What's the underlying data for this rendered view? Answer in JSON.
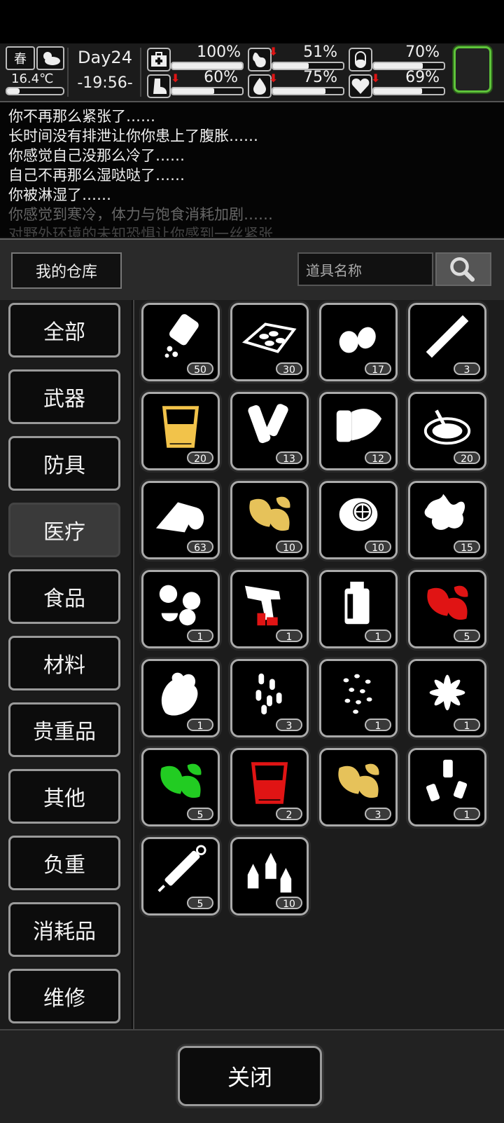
{
  "hud": {
    "season": "春",
    "temperature": "16.4℃",
    "day": "Day24",
    "time": "-19:56-",
    "stats": [
      {
        "name": "health",
        "icon": "medkit-icon",
        "value": "100%",
        "level": 1.0,
        "falling": false
      },
      {
        "name": "hunger",
        "icon": "stomach-icon",
        "value": "51%",
        "level": 0.51,
        "falling": true
      },
      {
        "name": "energy",
        "icon": "pill-icon",
        "value": "70%",
        "level": 0.7,
        "falling": false
      },
      {
        "name": "stamina",
        "icon": "boot-icon",
        "value": "60%",
        "level": 0.6,
        "falling": true
      },
      {
        "name": "thirst",
        "icon": "water-drop-icon",
        "value": "75%",
        "level": 0.75,
        "falling": true
      },
      {
        "name": "mood",
        "icon": "heart-icon",
        "value": "69%",
        "level": 0.69,
        "falling": true
      }
    ],
    "accent": "#5ec43a"
  },
  "log": [
    "你不再那么紧张了……",
    "长时间没有排泄让你你患上了腹胀……",
    "你感觉自己没那么冷了……",
    "自己不再那么湿哒哒了……",
    "你被淋湿了……",
    "你感觉到寒冷，体力与饱食消耗加剧……",
    "对野外环境的未知恐惧让你感到一丝紧张"
  ],
  "storage": {
    "title": "我的仓库",
    "search_placeholder": "道具名称"
  },
  "categories": [
    "全部",
    "武器",
    "防具",
    "医疗",
    "食品",
    "材料",
    "贵重品",
    "其他",
    "负重",
    "消耗品",
    "维修"
  ],
  "selected_category": "医疗",
  "items": [
    {
      "icon": "pill-bottle-icon",
      "qty": "50",
      "color": "#ffffff"
    },
    {
      "icon": "blister-pack-icon",
      "qty": "30",
      "color": "#ffffff"
    },
    {
      "icon": "seeds-icon",
      "qty": "17",
      "color": "#ffffff"
    },
    {
      "icon": "cigarette-icon",
      "qty": "3",
      "color": "#ffffff"
    },
    {
      "icon": "glass-yellow-icon",
      "qty": "20",
      "color": "#f2c34a"
    },
    {
      "icon": "bandage-roll-icon",
      "qty": "13",
      "color": "#ffffff"
    },
    {
      "icon": "gauze-icon",
      "qty": "12",
      "color": "#ffffff"
    },
    {
      "icon": "bowl-icon",
      "qty": "20",
      "color": "#ffffff"
    },
    {
      "icon": "tape-roll-icon",
      "qty": "63",
      "color": "#ffffff"
    },
    {
      "icon": "herb-yellow-icon",
      "qty": "10",
      "color": "#e6c25a"
    },
    {
      "icon": "lemon-icon",
      "qty": "10",
      "color": "#ffffff"
    },
    {
      "icon": "ginger-icon",
      "qty": "15",
      "color": "#ffffff"
    },
    {
      "icon": "tablets-icon",
      "qty": "1",
      "color": "#ffffff"
    },
    {
      "icon": "flare-gun-icon",
      "qty": "1",
      "color": "#ffffff"
    },
    {
      "icon": "vial-icon",
      "qty": "1",
      "color": "#ffffff"
    },
    {
      "icon": "herb-red-icon",
      "qty": "5",
      "color": "#e01414"
    },
    {
      "icon": "root-icon",
      "qty": "1",
      "color": "#ffffff"
    },
    {
      "icon": "capsules-icon",
      "qty": "3",
      "color": "#ffffff"
    },
    {
      "icon": "grains-icon",
      "qty": "1",
      "color": "#ffffff"
    },
    {
      "icon": "star-anise-icon",
      "qty": "1",
      "color": "#ffffff"
    },
    {
      "icon": "herb-green-icon",
      "qty": "5",
      "color": "#22cc22"
    },
    {
      "icon": "glass-red-icon",
      "qty": "2",
      "color": "#e01414"
    },
    {
      "icon": "herb-yellow-icon",
      "qty": "3",
      "color": "#e6c25a"
    },
    {
      "icon": "small-bottles-icon",
      "qty": "1",
      "color": "#ffffff"
    },
    {
      "icon": "syringe-icon",
      "qty": "5",
      "color": "#ffffff"
    },
    {
      "icon": "dropper-bottles-icon",
      "qty": "10",
      "color": "#ffffff"
    }
  ],
  "close_label": "关闭"
}
